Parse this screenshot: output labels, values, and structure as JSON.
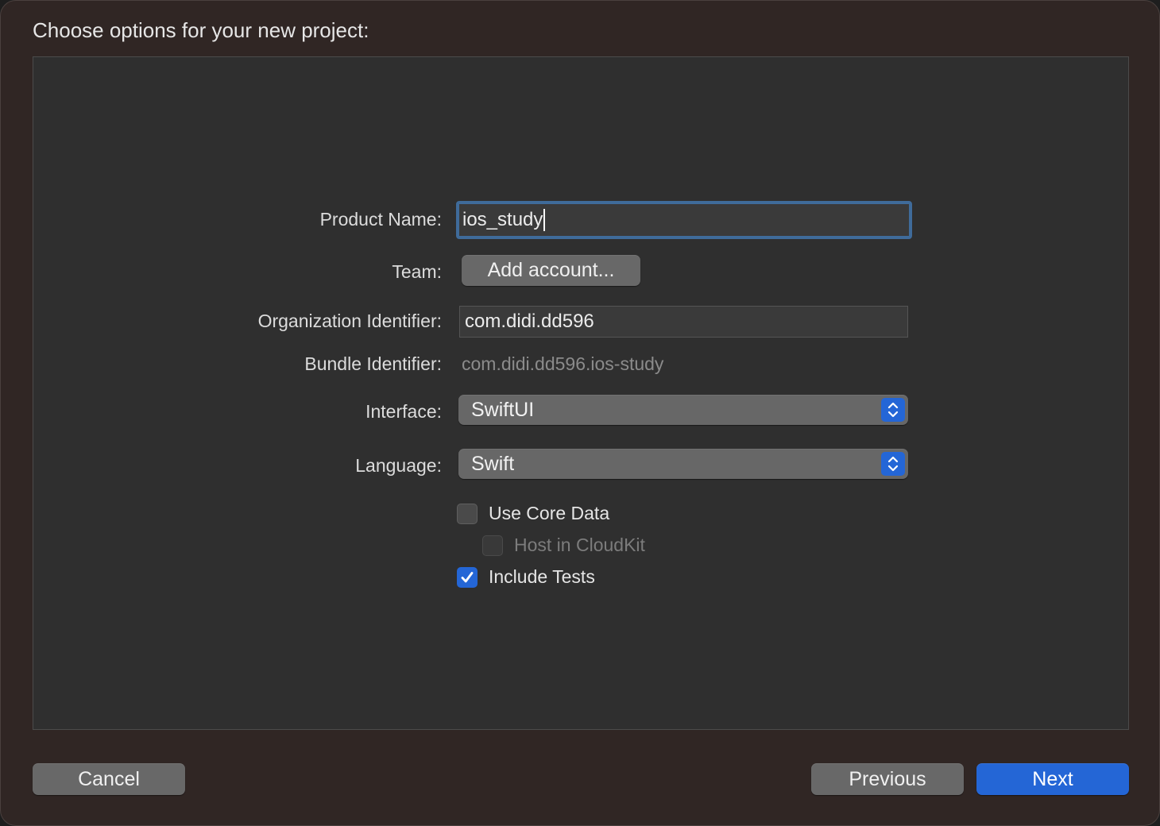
{
  "dialog": {
    "heading": "Choose options for your new project:"
  },
  "form": {
    "product_name": {
      "label": "Product Name:",
      "value": "ios_study"
    },
    "team": {
      "label": "Team:",
      "button": "Add account..."
    },
    "organization_identifier": {
      "label": "Organization Identifier:",
      "value": "com.didi.dd596"
    },
    "bundle_identifier": {
      "label": "Bundle Identifier:",
      "value": "com.didi.dd596.ios-study"
    },
    "interface": {
      "label": "Interface:",
      "selected": "SwiftUI"
    },
    "language": {
      "label": "Language:",
      "selected": "Swift"
    },
    "checkboxes": {
      "use_core_data": {
        "label": "Use Core Data",
        "checked": false
      },
      "host_in_cloudkit": {
        "label": "Host in CloudKit",
        "checked": false,
        "enabled": false
      },
      "include_tests": {
        "label": "Include Tests",
        "checked": true
      }
    }
  },
  "footer": {
    "cancel": "Cancel",
    "previous": "Previous",
    "next": "Next"
  },
  "colors": {
    "accent": "#2466d6",
    "window_bg": "#302624",
    "panel_bg": "#2f2f2f"
  },
  "icons": {
    "stepper": "up-down-chevron-icon",
    "checkmark": "checkmark-icon"
  }
}
